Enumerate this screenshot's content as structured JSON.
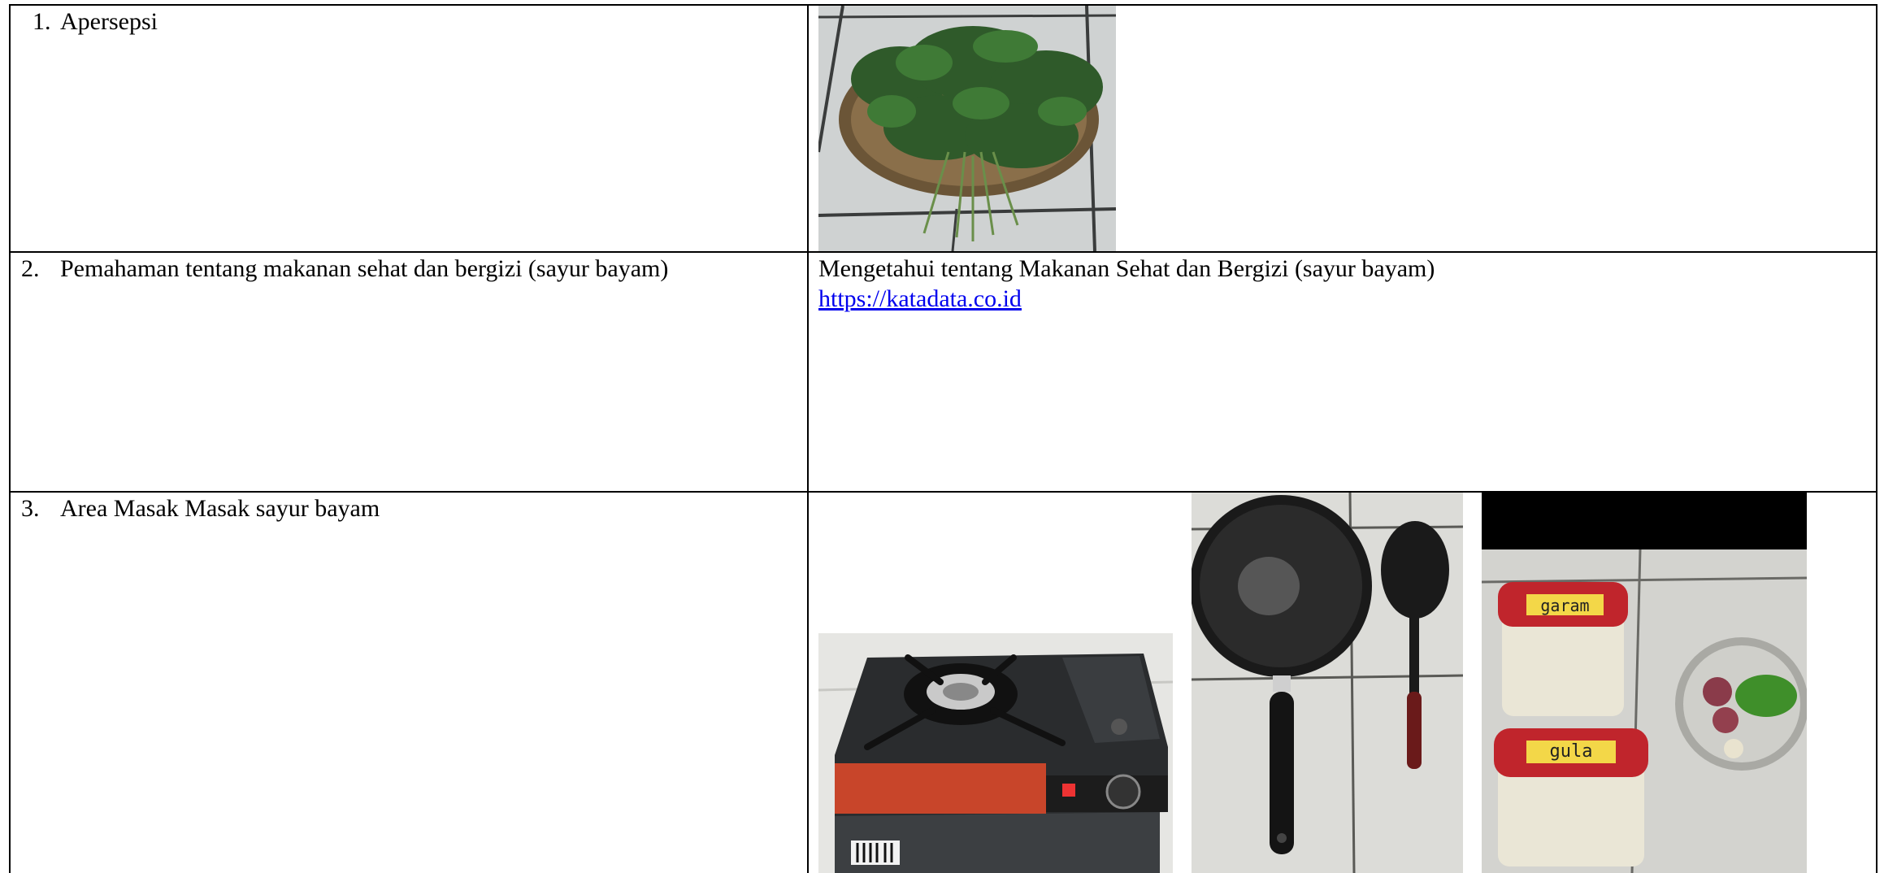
{
  "rows": [
    {
      "number": "1.",
      "label": "Apersepsi"
    },
    {
      "number": "2.",
      "label": "Pemahaman tentang makanan sehat dan bergizi (sayur bayam)",
      "content_text": "Mengetahui tentang Makanan Sehat dan Bergizi (sayur bayam)",
      "link_text": "https://katadata.co.id"
    },
    {
      "number": "3.",
      "label": "Area Masak Masak sayur bayam"
    }
  ],
  "photos": {
    "jar_label_1": "garam",
    "jar_label_2": "gula",
    "stove_icon": "portable-gas-stove",
    "spinach_icon": "spinach-basket",
    "pan_icon": "frying-pan-and-spatula",
    "jars_icon": "seasoning-jars"
  },
  "colors": {
    "link": "#0000ee",
    "border": "#000000"
  }
}
